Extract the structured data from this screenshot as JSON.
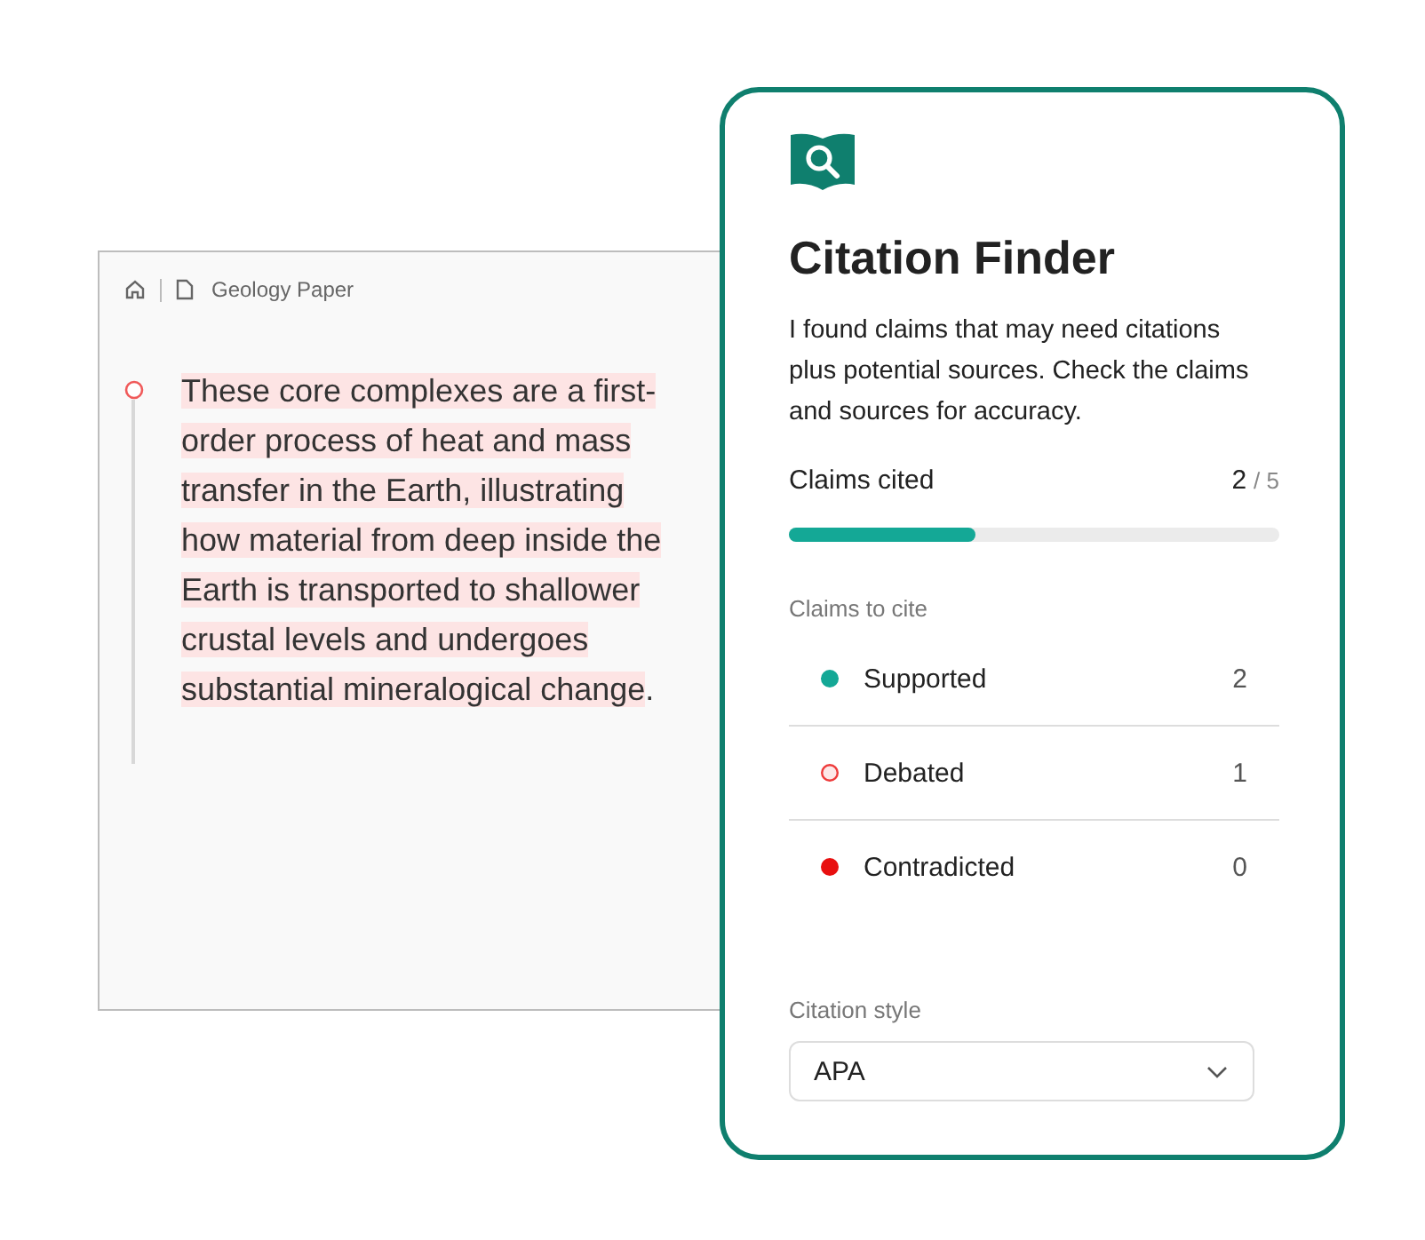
{
  "document": {
    "breadcrumb": "Geology Paper",
    "claim": {
      "highlighted": "These core complexes are a first-order process of heat and mass transfer in the Earth, illustrating how material from deep inside the Earth is transported to shallower crustal levels and undergoes substantial mineralogical change",
      "rest": "."
    }
  },
  "panel": {
    "title": "Citation Finder",
    "description": "I found claims that may need citations plus potential sources. Check the claims and sources for accuracy.",
    "progress": {
      "label": "Claims cited",
      "count": "2",
      "total": "/ 5",
      "level": 0.38
    },
    "claims_heading": "Claims to cite",
    "claims": [
      {
        "label": "Supported",
        "count": "2",
        "kind": "filled",
        "color": "#14a896"
      },
      {
        "label": "Debated",
        "count": "1",
        "kind": "hollow",
        "color": "#ee3b3b"
      },
      {
        "label": "Contradicted",
        "count": "0",
        "kind": "filled",
        "color": "#e80f0f"
      }
    ],
    "citation_style": {
      "label": "Citation style",
      "value": "APA"
    }
  }
}
